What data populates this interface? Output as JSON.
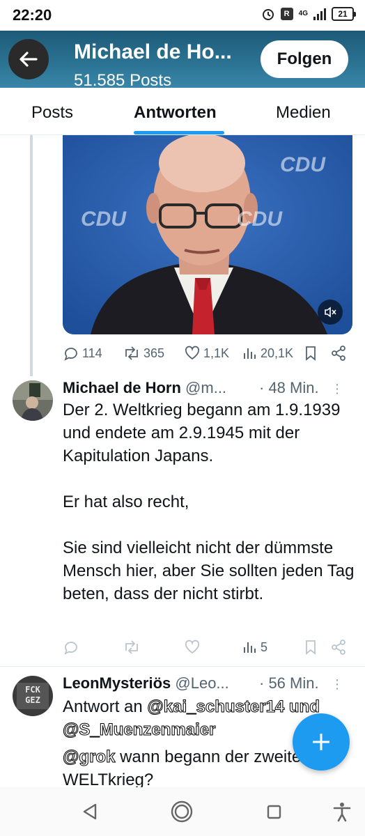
{
  "status_bar": {
    "time": "22:20",
    "battery": "21",
    "network": "4G",
    "alarm": "alarm-icon"
  },
  "header": {
    "name": "Michael de Ho...",
    "posts": "51.585 Posts",
    "follow_label": "Folgen"
  },
  "tabs": [
    {
      "label": "Posts",
      "active": false
    },
    {
      "label": "Antworten",
      "active": true
    },
    {
      "label": "Medien",
      "active": false
    }
  ],
  "video": {
    "overlay_text": "CDU"
  },
  "first_post_actions": {
    "replies": "114",
    "reposts": "365",
    "likes": "1,1K",
    "views": "20,1K"
  },
  "tweet1": {
    "name": "Michael de Horn",
    "handle": "@m...",
    "time": "· 48 Min.",
    "paragraphs": [
      "Der 2. Weltkrieg begann am 1.9.1939 und endete am 2.9.1945 mit der Kapitulation Japans.",
      "Er hat also recht,",
      "Sie sind vielleicht nicht der dümmste Mensch hier, aber Sie sollten jeden Tag beten, dass der nicht stirbt."
    ],
    "views": "5"
  },
  "tweet2": {
    "name": "LeonMysteriös",
    "handle": "@Leo...",
    "time": "· 56 Min.",
    "reply_prefix": "Antwort an",
    "reply_to_1": "@kai_schuster14 und",
    "reply_to_2": "@S_Muenzenmaier",
    "mention": "@grok",
    "text_1": " wann begann der zweite",
    "text_2": "WELTkrieg?",
    "avatar_text": "FCK GEZ"
  },
  "colors": {
    "accent": "#1d9bf0",
    "header_bg": "#2c7494",
    "text": "#0f1419",
    "muted": "#536471"
  }
}
